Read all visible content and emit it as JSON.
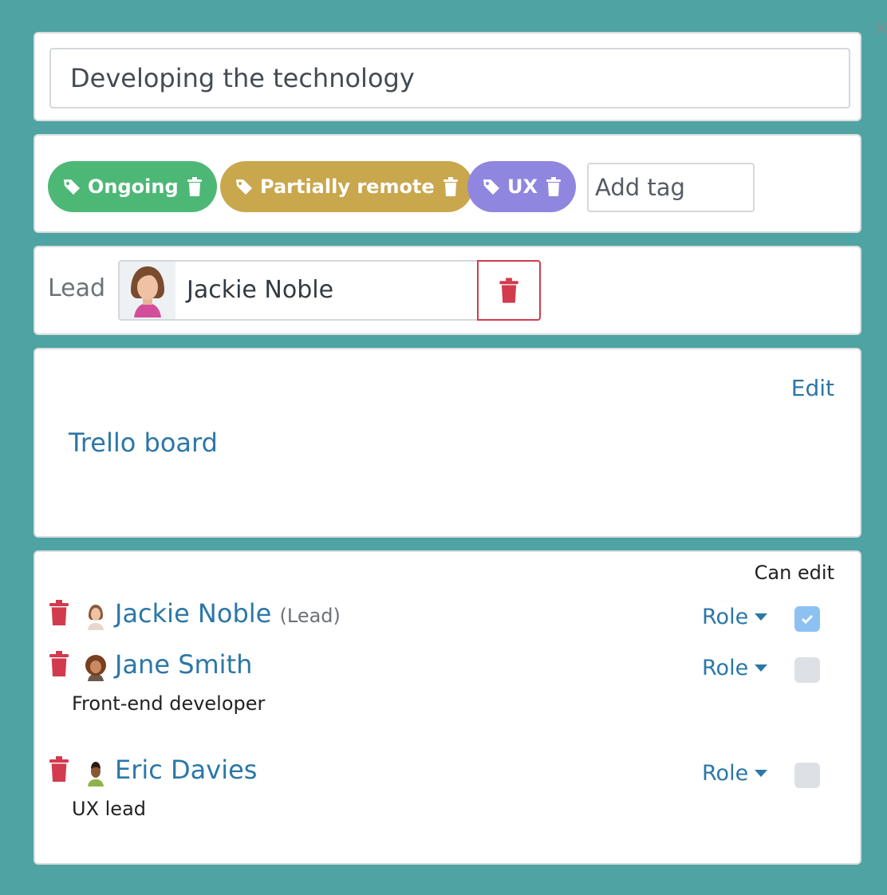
{
  "title": {
    "value": "Developing the technology"
  },
  "tags": {
    "items": [
      {
        "label": "Ongoing",
        "color": "#4db876"
      },
      {
        "label": "Partially remote",
        "color": "#c9a74d"
      },
      {
        "label": "UX",
        "color": "#8f86e0"
      }
    ],
    "add_placeholder": "Add tag"
  },
  "lead": {
    "label": "Lead",
    "name": "Jackie Noble"
  },
  "resources": {
    "edit_label": "Edit",
    "link_label": "Trello board"
  },
  "members": {
    "can_edit_header": "Can edit",
    "role_label": "Role",
    "list": [
      {
        "name": "Jackie Noble",
        "suffix": "(Lead)",
        "description": "",
        "can_edit": true,
        "avatar": "woman-avatar-icon"
      },
      {
        "name": "Jane Smith",
        "suffix": "",
        "description": "Front-end developer",
        "can_edit": false,
        "avatar": "curly-hair-avatar-icon"
      },
      {
        "name": "Eric Davies",
        "suffix": "",
        "description": "UX lead",
        "can_edit": false,
        "avatar": "man-avatar-icon"
      }
    ]
  },
  "colors": {
    "background": "#4fa3a2",
    "link": "#2b77a8",
    "danger": "#d23b4e",
    "check_on": "#8cc1f2"
  }
}
